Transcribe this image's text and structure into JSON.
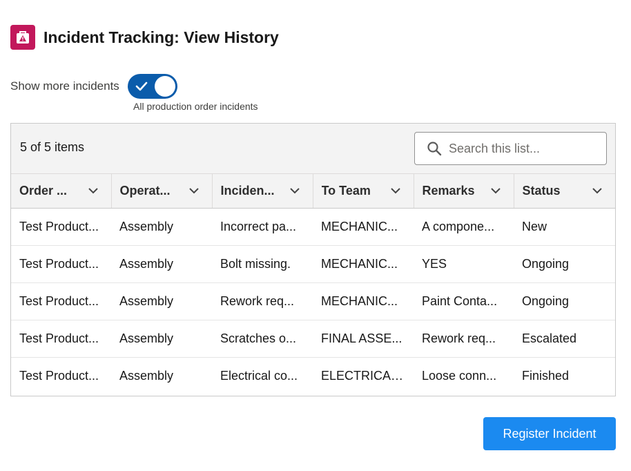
{
  "header": {
    "title": "Incident Tracking: View History",
    "icon": "warning-briefcase-icon"
  },
  "toggle": {
    "label": "Show more incidents",
    "checked": true,
    "sublabel": "All production order incidents"
  },
  "table": {
    "item_count": "5 of 5 items",
    "search_placeholder": "Search this list...",
    "columns": [
      "Order ...",
      "Operat...",
      "Inciden...",
      "To Team",
      "Remarks",
      "Status"
    ],
    "rows": [
      [
        "Test Product...",
        "Assembly",
        "Incorrect pa...",
        "MECHANIC...",
        "A compone...",
        "New"
      ],
      [
        "Test Product...",
        "Assembly",
        "Bolt missing.",
        "MECHANIC...",
        "YES",
        "Ongoing"
      ],
      [
        "Test Product...",
        "Assembly",
        "Rework req...",
        "MECHANIC...",
        "Paint Conta...",
        "Ongoing"
      ],
      [
        "Test Product...",
        "Assembly",
        "Scratches o...",
        "FINAL ASSE...",
        "Rework req...",
        "Escalated"
      ],
      [
        "Test Product...",
        "Assembly",
        "Electrical co...",
        "ELECTRICAL...",
        "Loose conn...",
        "Finished"
      ]
    ]
  },
  "actions": {
    "register_label": "Register Incident"
  },
  "colors": {
    "accent": "#1b8af0",
    "toggle": "#0b5cab",
    "icon_bg": "#c2185b"
  }
}
